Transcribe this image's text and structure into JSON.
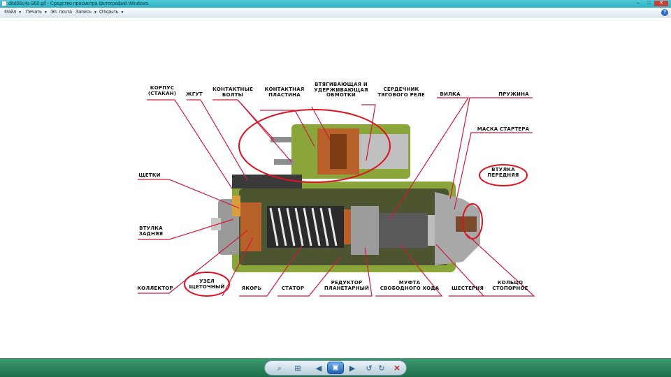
{
  "window": {
    "title": "d8d96c4s-960.gif - Средство просмотра фотографий Windows",
    "minimize": "–",
    "maximize": "□",
    "close": "✕"
  },
  "menu": {
    "items": [
      {
        "label": "Файл"
      },
      {
        "label": "Печать"
      },
      {
        "label": "Эл. почта"
      },
      {
        "label": "Запись"
      },
      {
        "label": "Открыть"
      }
    ],
    "help": "?"
  },
  "image": {
    "labels": {
      "korpus": "КОРПУС\n(СТАКАН)",
      "zhgut": "ЖГУТ",
      "kontaktnye_bolty": "КОНТАКТНЫЕ\nБОЛТЫ",
      "kontaktnaya_plastina": "КОНТАКТНАЯ\nПЛАСТИНА",
      "obmotki": "ВТЯГИВАЮЩАЯ И\nУДЕРЖИВАЮЩАЯ\nОБМОТКИ",
      "serdechnik": "СЕРДЕЧНИК\nТЯГОВОГО РЕЛЕ",
      "vilka": "ВИЛКА",
      "pruzhina": "ПРУЖИНА",
      "maska": "МАСКА СТАРТЕРА",
      "shchetki": "ЩЕТКИ",
      "vtulka_perednyaya": "ВТУЛКА\nПЕРЕДНЯЯ",
      "vtulka_zadnyaya": "ВТУЛКА\nЗАДНЯЯ",
      "kollektor": "КОЛЛЕКТОР",
      "uzel": "УЗЕЛ\nЩЕТОЧНЫЙ",
      "yakor": "ЯКОРЬ",
      "stator": "СТАТОР",
      "reduktor": "РЕДУКТОР\nПЛАНЕТАРНЫЙ",
      "mufta": "МУФТА\nСВОБОДНОГО ХОДА",
      "shesternya": "ШЕСТЕРНЯ",
      "koltso": "КОЛЬЦО\nСТОПОРНОЕ"
    },
    "colors": {
      "leader": "#d2193a",
      "circle": "#e0101e",
      "housing": "#8aa63b",
      "copper": "#b8612a"
    }
  },
  "toolbar": {
    "buttons": [
      {
        "name": "zoom-icon",
        "glyph": "⌕"
      },
      {
        "name": "actual-size-icon",
        "glyph": "⊞"
      },
      {
        "name": "previous-icon",
        "glyph": "◀"
      },
      {
        "name": "slideshow-icon",
        "glyph": "▣"
      },
      {
        "name": "next-icon",
        "glyph": "▶"
      },
      {
        "name": "rotate-left-icon",
        "glyph": "↺"
      },
      {
        "name": "rotate-right-icon",
        "glyph": "↻"
      },
      {
        "name": "delete-icon",
        "glyph": "✕"
      }
    ]
  }
}
